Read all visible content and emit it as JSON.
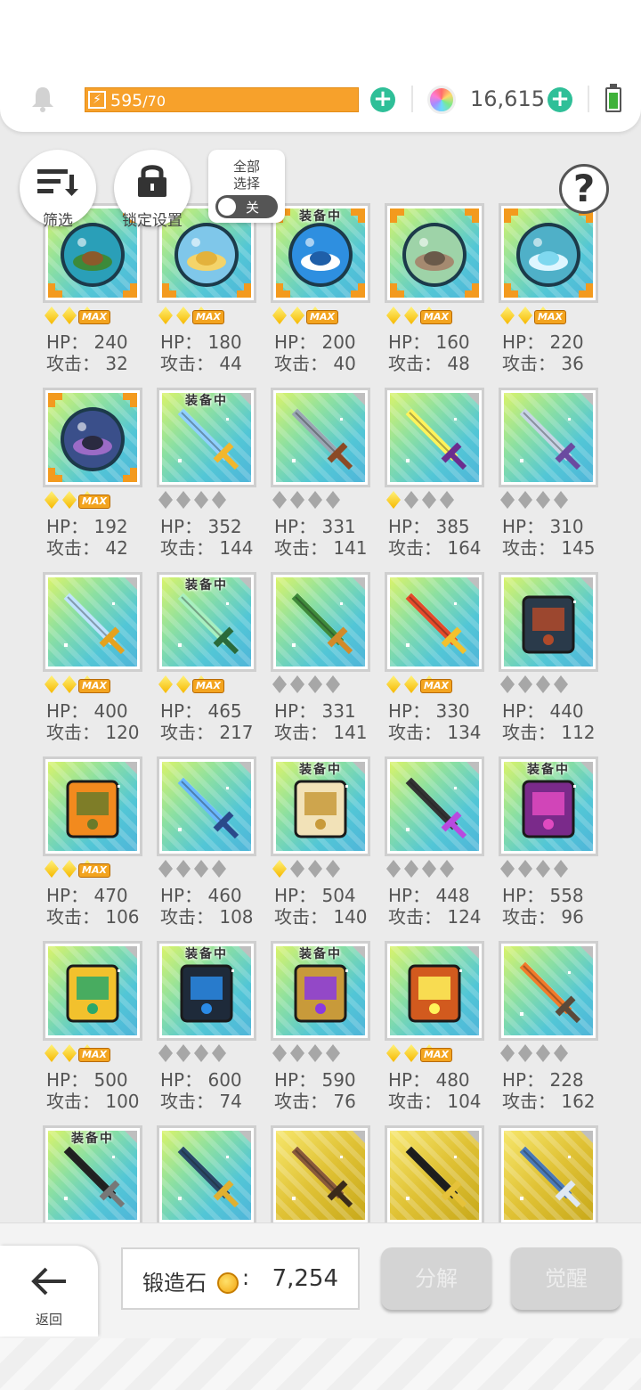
{
  "header": {
    "energy_current": "595",
    "energy_max": "/70",
    "gems": "16,615",
    "icons": [
      "bell-icon",
      "lightning-icon",
      "plus-icon",
      "rainbow-gem-icon",
      "battery-icon"
    ]
  },
  "controls": {
    "filter_label": "筛选",
    "lock_label": "锁定设置",
    "select_all_line1": "全部",
    "select_all_line2": "选择",
    "toggle_state": "关",
    "help": "?"
  },
  "stat_labels": {
    "hp": "HP：",
    "atk": "攻击：",
    "equipped": "装备中",
    "max": "MAX"
  },
  "items": [
    {
      "hp": "240",
      "atk": "32",
      "stars": "max",
      "equipped": false,
      "art": "orb-island",
      "frame": "orb"
    },
    {
      "hp": "180",
      "atk": "44",
      "stars": "max",
      "equipped": false,
      "art": "orb-desert",
      "frame": "orb"
    },
    {
      "hp": "200",
      "atk": "40",
      "stars": "max",
      "equipped": true,
      "art": "orb-ship",
      "frame": "orb"
    },
    {
      "hp": "160",
      "atk": "48",
      "stars": "max",
      "equipped": false,
      "art": "orb-rock",
      "frame": "orb"
    },
    {
      "hp": "220",
      "atk": "36",
      "stars": "max",
      "equipped": false,
      "art": "orb-crystal",
      "frame": "orb"
    },
    {
      "hp": "192",
      "atk": "42",
      "stars": "max",
      "equipped": false,
      "art": "orb-cave",
      "frame": "orb"
    },
    {
      "hp": "352",
      "atk": "144",
      "stars": "0",
      "equipped": true,
      "art": "sword-blue",
      "frame": "plain"
    },
    {
      "hp": "331",
      "atk": "141",
      "stars": "0",
      "equipped": false,
      "art": "crossed-axes",
      "frame": "plain"
    },
    {
      "hp": "385",
      "atk": "164",
      "stars": "1",
      "equipped": false,
      "art": "lightning-blade",
      "frame": "plain"
    },
    {
      "hp": "310",
      "atk": "145",
      "stars": "0",
      "equipped": false,
      "art": "shuriken-sword",
      "frame": "plain"
    },
    {
      "hp": "400",
      "atk": "120",
      "stars": "max",
      "equipped": false,
      "art": "sword-gold",
      "frame": "plain"
    },
    {
      "hp": "465",
      "atk": "217",
      "stars": "max",
      "equipped": true,
      "art": "trident",
      "frame": "plain"
    },
    {
      "hp": "331",
      "atk": "141",
      "stars": "0",
      "equipped": false,
      "art": "wand-vine",
      "frame": "plain"
    },
    {
      "hp": "330",
      "atk": "134",
      "stars": "max",
      "equipped": false,
      "art": "spear-red",
      "frame": "plain"
    },
    {
      "hp": "440",
      "atk": "112",
      "stars": "0",
      "equipped": false,
      "art": "tome-dark",
      "frame": "plain"
    },
    {
      "hp": "470",
      "atk": "106",
      "stars": "max",
      "equipped": false,
      "art": "book-orange",
      "frame": "plain"
    },
    {
      "hp": "460",
      "atk": "108",
      "stars": "0",
      "equipped": false,
      "art": "staff-blue",
      "frame": "plain"
    },
    {
      "hp": "504",
      "atk": "140",
      "stars": "1",
      "equipped": true,
      "art": "scroll-maze",
      "frame": "plain"
    },
    {
      "hp": "448",
      "atk": "124",
      "stars": "0",
      "equipped": false,
      "art": "gauntlet-purple",
      "frame": "plain"
    },
    {
      "hp": "558",
      "atk": "96",
      "stars": "0",
      "equipped": true,
      "art": "shield-purple",
      "frame": "plain"
    },
    {
      "hp": "500",
      "atk": "100",
      "stars": "max",
      "equipped": false,
      "art": "shield-gold",
      "frame": "plain"
    },
    {
      "hp": "600",
      "atk": "74",
      "stars": "0",
      "equipped": true,
      "art": "chip-card",
      "frame": "plain"
    },
    {
      "hp": "590",
      "atk": "76",
      "stars": "0",
      "equipped": true,
      "art": "amulet",
      "frame": "plain"
    },
    {
      "hp": "480",
      "atk": "104",
      "stars": "max",
      "equipped": false,
      "art": "belt-lightning",
      "frame": "plain"
    },
    {
      "hp": "228",
      "atk": "162",
      "stars": "0",
      "equipped": false,
      "art": "rocket-gun",
      "frame": "plain"
    },
    {
      "hp": "",
      "atk": "",
      "stars": "",
      "equipped": true,
      "art": "rifle-black",
      "frame": "plain"
    },
    {
      "hp": "",
      "atk": "",
      "stars": "",
      "equipped": false,
      "art": "sniper",
      "frame": "plain"
    },
    {
      "hp": "",
      "atk": "",
      "stars": "",
      "equipped": false,
      "art": "blade-brown",
      "frame": "gold"
    },
    {
      "hp": "",
      "atk": "",
      "stars": "",
      "equipped": false,
      "art": "spear-gold",
      "frame": "gold"
    },
    {
      "hp": "",
      "atk": "",
      "stars": "",
      "equipped": false,
      "art": "halberd-blue",
      "frame": "gold"
    }
  ],
  "footer": {
    "back_label": "返回",
    "stone_label": "锻造石",
    "stone_colon": ":",
    "stone_value": "7,254",
    "disassemble_label": "分解",
    "awaken_label": "觉醒"
  },
  "colors": {
    "energy": "#f7a12b",
    "plus": "#2fbf98",
    "orb_corner": "#f39a1e",
    "disabled_button": "#d4d4d4"
  }
}
